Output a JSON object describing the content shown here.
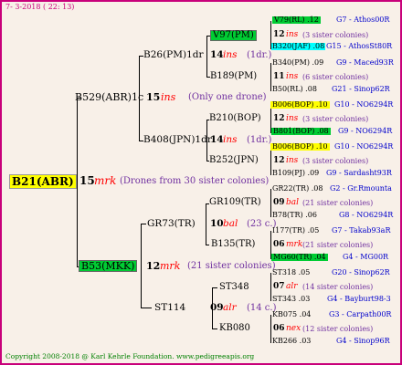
{
  "header": {
    "date": "7-  3-2018  ( 22: 13)"
  },
  "footer": {
    "copyright": "Copyright 2008-2018 @ Karl Kehrle Foundation.   www.pedigreeapis.org"
  },
  "root": {
    "name": "B21(ABR)",
    "num": "15",
    "breed": "mrk",
    "desc": "(Drones from 30 sister colonies)"
  },
  "gen1": {
    "top": {
      "name": "B529(ABR)1c",
      "num": "15",
      "breed": "ins",
      "desc": "(Only one drone)"
    },
    "bottom": {
      "name": "B53(MKK)",
      "num": "12",
      "breed": "mrk",
      "desc": "(21 sister colonies)"
    }
  },
  "gen2": [
    {
      "name": "B26(PM)1dr",
      "num": "14",
      "breed": "ins",
      "desc": "(1dr.)"
    },
    {
      "name": "B408(JPN)1dr",
      "num": "14",
      "breed": "ins",
      "desc": "(1dr.)"
    },
    {
      "name": "GR73(TR)",
      "num": "10",
      "breed": "bal",
      "desc": "(23 c.)"
    },
    {
      "name": "ST114",
      "num": "09",
      "breed": "alr",
      "desc": "(14 c.)"
    }
  ],
  "gen3": [
    {
      "name": "V97(PM)",
      "num": "12",
      "breed": "ins",
      "desc": "(3 sister colonies)"
    },
    {
      "name": "B189(PM)",
      "num": "11",
      "breed": "ins",
      "desc": "(6 sister colonies)"
    },
    {
      "name": "B210(BOP)",
      "num": "12",
      "breed": "ins",
      "desc": "(3 sister colonies)"
    },
    {
      "name": "B252(JPN)",
      "num": "12",
      "breed": "ins",
      "desc": "(3 sister colonies)"
    },
    {
      "name": "GR109(TR)",
      "num": "09",
      "breed": "bal",
      "desc": "(21 sister colonies)"
    },
    {
      "name": "B135(TR)",
      "num": "06",
      "breed": "mrk",
      "desc": "(21 sister colonies)"
    },
    {
      "name": "ST348",
      "num": "07",
      "breed": "alr",
      "desc": "(14 sister colonies)"
    },
    {
      "name": "KB080",
      "num": "06",
      "breed": "nex",
      "desc": "(12 sister colonies)"
    }
  ],
  "gen4": [
    {
      "name": "V79(RL) .12",
      "info": "G7 - Athos00R"
    },
    {
      "name": "B320(JAF) .08",
      "info": "G15 - AthosSt80R"
    },
    {
      "name": "B340(PM) .09",
      "info": "G9 - Maced93R"
    },
    {
      "name": "B50(RL) .08",
      "info": "G21 - Sinop62R"
    },
    {
      "name": "B006(BOP) .10",
      "info": "G10 - NO6294R"
    },
    {
      "name": "B801(BOP) .08",
      "info": "G9 - NO6294R"
    },
    {
      "name": "B006(BOP) .10",
      "info": "G10 - NO6294R"
    },
    {
      "name": "B109(PJ) .09",
      "info": "G9 - Sardasht93R"
    },
    {
      "name": "GR22(TR) .08",
      "info": "G2 - Gr.Rmounta"
    },
    {
      "name": "B78(TR) .06",
      "info": "G8 - NO6294R"
    },
    {
      "name": "I177(TR) .05",
      "info": "G7 - Takab93aR"
    },
    {
      "name": "MG60(TR) .04",
      "info": "G4 - MG00R"
    },
    {
      "name": "ST318 .05",
      "info": "G20 - Sinop62R"
    },
    {
      "name": "ST343 .03",
      "info": "G4 - Bayburt98-3"
    },
    {
      "name": "KB075 .04",
      "info": "G3 - Carpath00R"
    },
    {
      "name": "KB266 .03",
      "info": "G4 - Sinop96R"
    }
  ]
}
